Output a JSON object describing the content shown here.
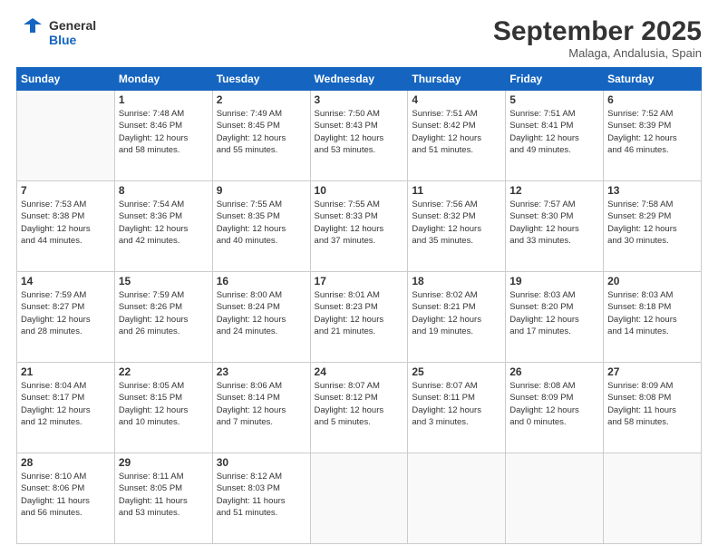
{
  "header": {
    "logo_line1": "General",
    "logo_line2": "Blue",
    "month": "September 2025",
    "location": "Malaga, Andalusia, Spain"
  },
  "days_of_week": [
    "Sunday",
    "Monday",
    "Tuesday",
    "Wednesday",
    "Thursday",
    "Friday",
    "Saturday"
  ],
  "weeks": [
    [
      {
        "day": "",
        "info": ""
      },
      {
        "day": "1",
        "info": "Sunrise: 7:48 AM\nSunset: 8:46 PM\nDaylight: 12 hours\nand 58 minutes."
      },
      {
        "day": "2",
        "info": "Sunrise: 7:49 AM\nSunset: 8:45 PM\nDaylight: 12 hours\nand 55 minutes."
      },
      {
        "day": "3",
        "info": "Sunrise: 7:50 AM\nSunset: 8:43 PM\nDaylight: 12 hours\nand 53 minutes."
      },
      {
        "day": "4",
        "info": "Sunrise: 7:51 AM\nSunset: 8:42 PM\nDaylight: 12 hours\nand 51 minutes."
      },
      {
        "day": "5",
        "info": "Sunrise: 7:51 AM\nSunset: 8:41 PM\nDaylight: 12 hours\nand 49 minutes."
      },
      {
        "day": "6",
        "info": "Sunrise: 7:52 AM\nSunset: 8:39 PM\nDaylight: 12 hours\nand 46 minutes."
      }
    ],
    [
      {
        "day": "7",
        "info": "Sunrise: 7:53 AM\nSunset: 8:38 PM\nDaylight: 12 hours\nand 44 minutes."
      },
      {
        "day": "8",
        "info": "Sunrise: 7:54 AM\nSunset: 8:36 PM\nDaylight: 12 hours\nand 42 minutes."
      },
      {
        "day": "9",
        "info": "Sunrise: 7:55 AM\nSunset: 8:35 PM\nDaylight: 12 hours\nand 40 minutes."
      },
      {
        "day": "10",
        "info": "Sunrise: 7:55 AM\nSunset: 8:33 PM\nDaylight: 12 hours\nand 37 minutes."
      },
      {
        "day": "11",
        "info": "Sunrise: 7:56 AM\nSunset: 8:32 PM\nDaylight: 12 hours\nand 35 minutes."
      },
      {
        "day": "12",
        "info": "Sunrise: 7:57 AM\nSunset: 8:30 PM\nDaylight: 12 hours\nand 33 minutes."
      },
      {
        "day": "13",
        "info": "Sunrise: 7:58 AM\nSunset: 8:29 PM\nDaylight: 12 hours\nand 30 minutes."
      }
    ],
    [
      {
        "day": "14",
        "info": "Sunrise: 7:59 AM\nSunset: 8:27 PM\nDaylight: 12 hours\nand 28 minutes."
      },
      {
        "day": "15",
        "info": "Sunrise: 7:59 AM\nSunset: 8:26 PM\nDaylight: 12 hours\nand 26 minutes."
      },
      {
        "day": "16",
        "info": "Sunrise: 8:00 AM\nSunset: 8:24 PM\nDaylight: 12 hours\nand 24 minutes."
      },
      {
        "day": "17",
        "info": "Sunrise: 8:01 AM\nSunset: 8:23 PM\nDaylight: 12 hours\nand 21 minutes."
      },
      {
        "day": "18",
        "info": "Sunrise: 8:02 AM\nSunset: 8:21 PM\nDaylight: 12 hours\nand 19 minutes."
      },
      {
        "day": "19",
        "info": "Sunrise: 8:03 AM\nSunset: 8:20 PM\nDaylight: 12 hours\nand 17 minutes."
      },
      {
        "day": "20",
        "info": "Sunrise: 8:03 AM\nSunset: 8:18 PM\nDaylight: 12 hours\nand 14 minutes."
      }
    ],
    [
      {
        "day": "21",
        "info": "Sunrise: 8:04 AM\nSunset: 8:17 PM\nDaylight: 12 hours\nand 12 minutes."
      },
      {
        "day": "22",
        "info": "Sunrise: 8:05 AM\nSunset: 8:15 PM\nDaylight: 12 hours\nand 10 minutes."
      },
      {
        "day": "23",
        "info": "Sunrise: 8:06 AM\nSunset: 8:14 PM\nDaylight: 12 hours\nand 7 minutes."
      },
      {
        "day": "24",
        "info": "Sunrise: 8:07 AM\nSunset: 8:12 PM\nDaylight: 12 hours\nand 5 minutes."
      },
      {
        "day": "25",
        "info": "Sunrise: 8:07 AM\nSunset: 8:11 PM\nDaylight: 12 hours\nand 3 minutes."
      },
      {
        "day": "26",
        "info": "Sunrise: 8:08 AM\nSunset: 8:09 PM\nDaylight: 12 hours\nand 0 minutes."
      },
      {
        "day": "27",
        "info": "Sunrise: 8:09 AM\nSunset: 8:08 PM\nDaylight: 11 hours\nand 58 minutes."
      }
    ],
    [
      {
        "day": "28",
        "info": "Sunrise: 8:10 AM\nSunset: 8:06 PM\nDaylight: 11 hours\nand 56 minutes."
      },
      {
        "day": "29",
        "info": "Sunrise: 8:11 AM\nSunset: 8:05 PM\nDaylight: 11 hours\nand 53 minutes."
      },
      {
        "day": "30",
        "info": "Sunrise: 8:12 AM\nSunset: 8:03 PM\nDaylight: 11 hours\nand 51 minutes."
      },
      {
        "day": "",
        "info": ""
      },
      {
        "day": "",
        "info": ""
      },
      {
        "day": "",
        "info": ""
      },
      {
        "day": "",
        "info": ""
      }
    ]
  ]
}
